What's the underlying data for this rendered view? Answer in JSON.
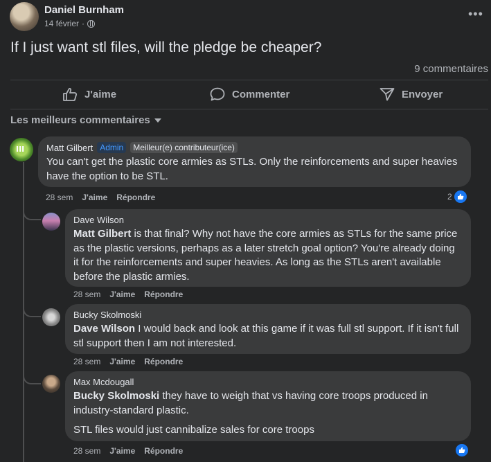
{
  "post": {
    "author": "Daniel Burnham",
    "date": "14 février",
    "separator": "·",
    "title": "If I just want stl files, will the pledge be cheaper?",
    "comment_count": "9 commentaires"
  },
  "actions": {
    "like": "J'aime",
    "comment": "Commenter",
    "share": "Envoyer"
  },
  "sort_label": "Les meilleurs commentaires",
  "comments": [
    {
      "author": "Matt Gilbert",
      "badge_admin": "Admin",
      "badge_top": "Meilleur(e) contributeur(ice)",
      "text": "You can't get the plastic core armies as STLs. Only the reinforcements and super heavies have the option to be STL.",
      "time": "28 sem",
      "like_label": "J'aime",
      "reply_label": "Répondre",
      "reaction_count": "2"
    },
    {
      "author": "Dave Wilson",
      "mention": "Matt Gilbert",
      "text": " is that final? Why not have the core armies as STLs for the same price as the plastic versions, perhaps as a later stretch goal option? You're already doing it for the reinforcements and super heavies. As long as the STLs aren't available before the plastic armies.",
      "time": "28 sem",
      "like_label": "J'aime",
      "reply_label": "Répondre"
    },
    {
      "author": "Bucky Skolmoski",
      "mention": "Dave Wilson",
      "text": " I would back and look at this game if it was full stl support. If it isn't full stl support then I am not interested.",
      "time": "28 sem",
      "like_label": "J'aime",
      "reply_label": "Répondre"
    },
    {
      "author": "Max Mcdougall",
      "mention": "Bucky Skolmoski",
      "text": " they have to weigh that vs having core troops produced in industry-standard plastic.",
      "text2": "STL files would just cannibalize sales for core troops",
      "time": "28 sem",
      "like_label": "J'aime",
      "reply_label": "Répondre"
    }
  ],
  "colors": {
    "background": "#242526",
    "bubble": "#3a3b3c",
    "text_primary": "#e4e6eb",
    "text_secondary": "#b0b3b8",
    "like_blue": "#1877f2",
    "admin_blue": "#4599ff"
  },
  "icons": [
    "globe-icon",
    "more-icon",
    "thumbs-up-icon",
    "comment-icon",
    "send-icon",
    "caret-down-icon",
    "like-reaction-icon"
  ]
}
